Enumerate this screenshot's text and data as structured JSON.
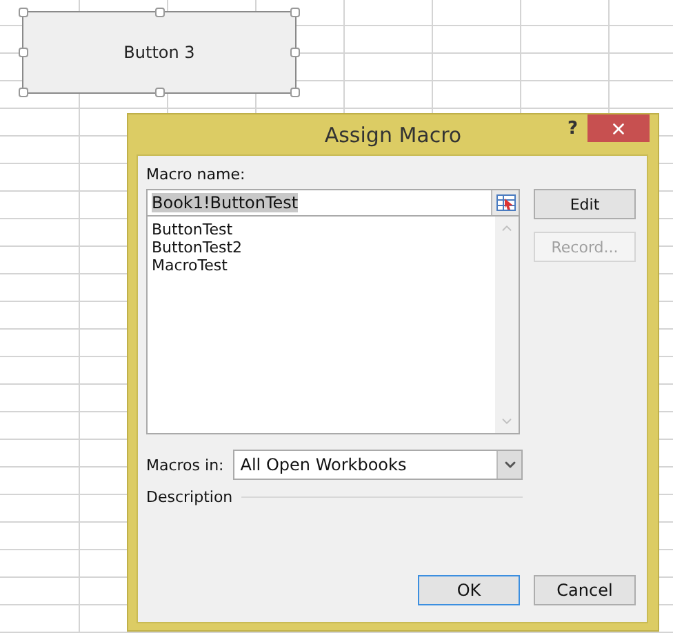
{
  "spreadsheet": {
    "shape_button": {
      "label": "Button 3",
      "selected": true
    }
  },
  "dialog": {
    "title": "Assign Macro",
    "help": "?",
    "macro_name": {
      "label": "Macro name:",
      "value": "Book1!ButtonTest",
      "value_selected": true
    },
    "macros": [
      {
        "name": "ButtonTest",
        "selected": false
      },
      {
        "name": "ButtonTest2",
        "selected": false
      },
      {
        "name": "MacroTest",
        "selected": false
      }
    ],
    "side_buttons": [
      {
        "label": "Edit",
        "disabled": false
      },
      {
        "label": "Record...",
        "disabled": true
      }
    ],
    "macros_in": {
      "label": "Macros in:",
      "value": "All Open Workbooks"
    },
    "description": {
      "label": "Description"
    },
    "buttons": [
      {
        "label": "OK",
        "default": true
      },
      {
        "label": "Cancel",
        "default": false
      }
    ]
  }
}
